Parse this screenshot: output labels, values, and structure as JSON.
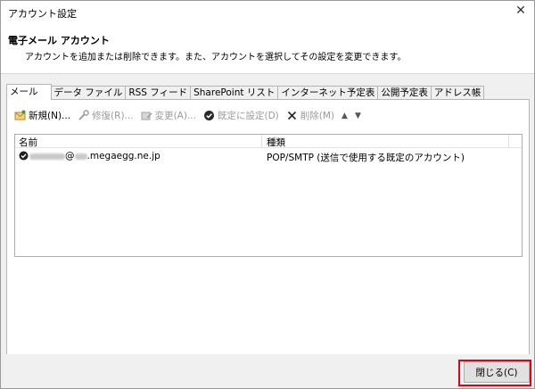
{
  "window": {
    "title": "アカウント設定",
    "close_glyph": "✕"
  },
  "header": {
    "title": "電子メール アカウント",
    "subtitle": "アカウントを追加または削除できます。また、アカウントを選択してその設定を変更できます。"
  },
  "tabs": [
    {
      "label": "メール",
      "active": true
    },
    {
      "label": "データ ファイル"
    },
    {
      "label": "RSS フィード"
    },
    {
      "label": "SharePoint リスト"
    },
    {
      "label": "インターネット予定表"
    },
    {
      "label": "公開予定表"
    },
    {
      "label": "アドレス帳"
    }
  ],
  "toolbar": {
    "new_label": "新規(N)...",
    "repair_label": "修復(R)...",
    "change_label": "変更(A)...",
    "default_label": "既定に設定(D)",
    "delete_label": "削除(M)",
    "icons": {
      "new": "new-mail-icon",
      "repair": "wrench-icon",
      "change": "change-icon",
      "default": "check-circle-icon",
      "delete": "delete-x-icon",
      "up": "arrow-up-icon",
      "down": "arrow-down-icon"
    },
    "up_glyph": "▲",
    "down_glyph": "▼"
  },
  "list": {
    "headers": {
      "name": "名前",
      "type": "種類"
    },
    "rows": [
      {
        "email_visible": "@",
        "email_domain": ".megaegg.ne.jp",
        "type": "POP/SMTP (送信で使用する既定のアカウント)"
      }
    ]
  },
  "footer": {
    "close_label": "閉じる(C)"
  },
  "colors": {
    "highlight": "#e60012",
    "checkmark": "#1f1f1f"
  }
}
